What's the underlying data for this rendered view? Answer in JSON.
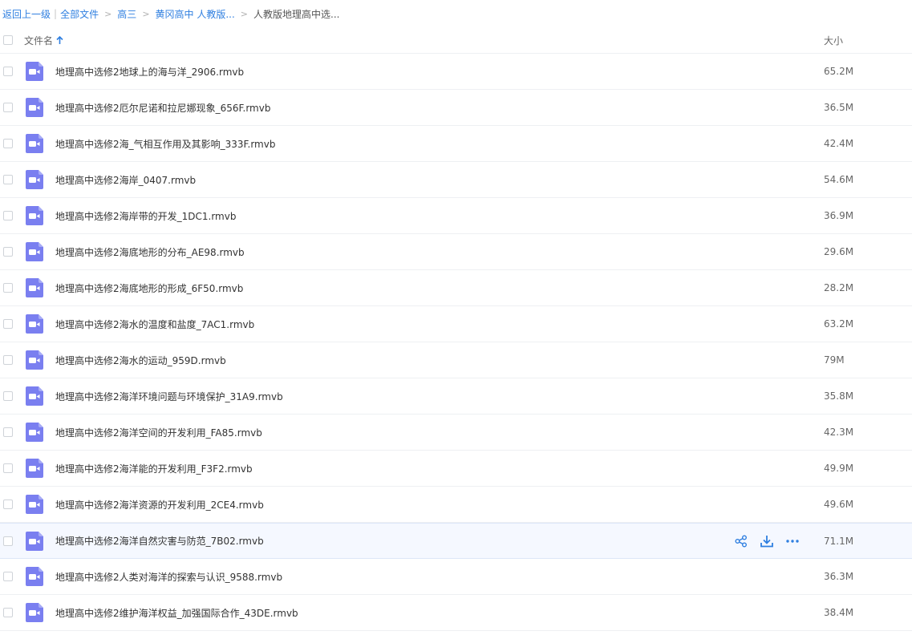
{
  "breadcrumb": {
    "back": "返回上一级",
    "root": "全部文件",
    "level1": "高三",
    "level2": "黄冈高中 人教版...",
    "current": "人教版地理高中选..."
  },
  "header": {
    "name_label": "文件名",
    "size_label": "大小"
  },
  "files": [
    {
      "name": "地理高中选修2地球上的海与洋_2906.rmvb",
      "size": "65.2M"
    },
    {
      "name": "地理高中选修2厄尔尼诺和拉尼娜现象_656F.rmvb",
      "size": "36.5M"
    },
    {
      "name": "地理高中选修2海_气相互作用及其影响_333F.rmvb",
      "size": "42.4M"
    },
    {
      "name": "地理高中选修2海岸_0407.rmvb",
      "size": "54.6M"
    },
    {
      "name": "地理高中选修2海岸带的开发_1DC1.rmvb",
      "size": "36.9M"
    },
    {
      "name": "地理高中选修2海底地形的分布_AE98.rmvb",
      "size": "29.6M"
    },
    {
      "name": "地理高中选修2海底地形的形成_6F50.rmvb",
      "size": "28.2M"
    },
    {
      "name": "地理高中选修2海水的温度和盐度_7AC1.rmvb",
      "size": "63.2M"
    },
    {
      "name": "地理高中选修2海水的运动_959D.rmvb",
      "size": "79M"
    },
    {
      "name": "地理高中选修2海洋环境问题与环境保护_31A9.rmvb",
      "size": "35.8M"
    },
    {
      "name": "地理高中选修2海洋空间的开发利用_FA85.rmvb",
      "size": "42.3M"
    },
    {
      "name": "地理高中选修2海洋能的开发利用_F3F2.rmvb",
      "size": "49.9M"
    },
    {
      "name": "地理高中选修2海洋资源的开发利用_2CE4.rmvb",
      "size": "49.6M"
    },
    {
      "name": "地理高中选修2海洋自然灾害与防范_7B02.rmvb",
      "size": "71.1M"
    },
    {
      "name": "地理高中选修2人类对海洋的探索与认识_9588.rmvb",
      "size": "36.3M"
    },
    {
      "name": "地理高中选修2维护海洋权益_加强国际合作_43DE.rmvb",
      "size": "38.4M"
    }
  ],
  "colors": {
    "accent": "#2f7fe0",
    "video_icon": "#7a7ff0",
    "action_icon": "#2f7fe0"
  }
}
